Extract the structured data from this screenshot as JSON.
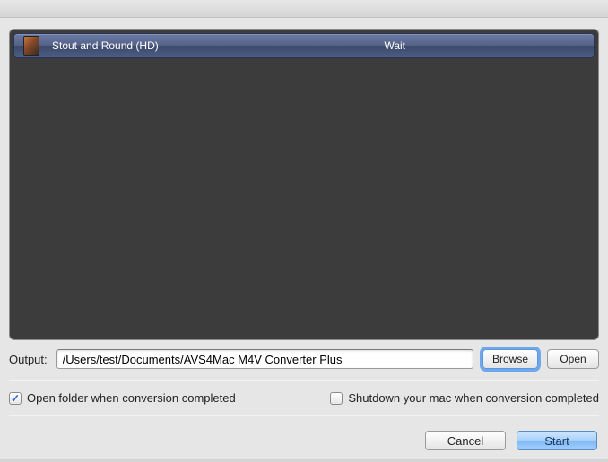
{
  "list": {
    "items": [
      {
        "title": "Stout and Round (HD)",
        "status": "Wait"
      }
    ]
  },
  "output": {
    "label": "Output:",
    "path": "/Users/test/Documents/AVS4Mac M4V Converter Plus",
    "browse": "Browse",
    "open": "Open"
  },
  "options": {
    "open_folder_label": "Open folder when conversion completed",
    "shutdown_label": "Shutdown your mac when conversion completed"
  },
  "footer": {
    "cancel": "Cancel",
    "start": "Start"
  }
}
